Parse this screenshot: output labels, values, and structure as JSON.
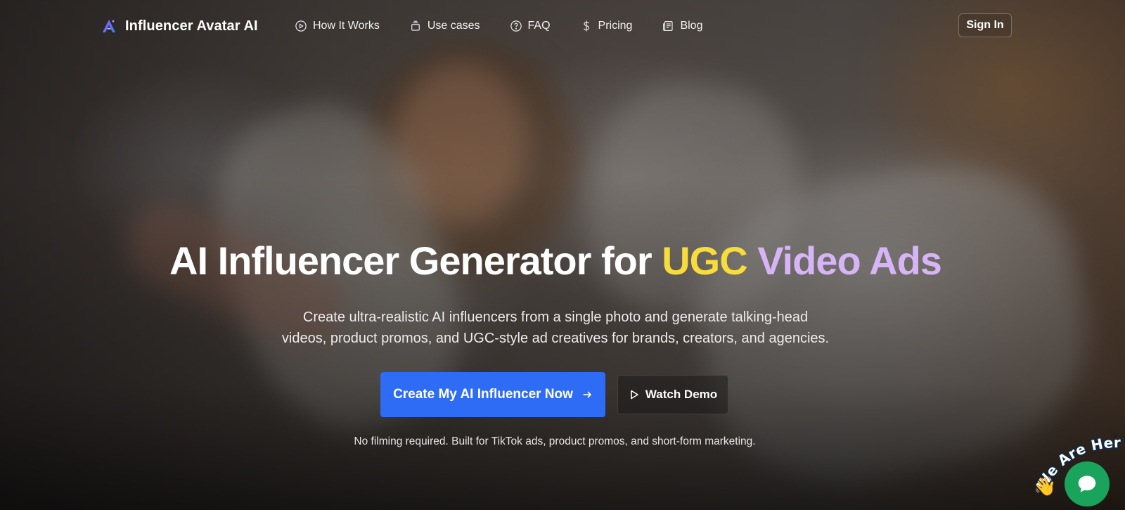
{
  "brand": {
    "name": "Influencer Avatar AI",
    "logo_icon": "a-logo-icon"
  },
  "nav": {
    "items": [
      {
        "label": "How It Works",
        "icon": "play-circle-icon"
      },
      {
        "label": "Use cases",
        "icon": "stack-icon"
      },
      {
        "label": "FAQ",
        "icon": "question-circle-icon"
      },
      {
        "label": "Pricing",
        "icon": "dollar-icon"
      },
      {
        "label": "Blog",
        "icon": "newspaper-icon"
      }
    ],
    "sign_in": "Sign In"
  },
  "hero": {
    "title_part1": "AI Influencer Generator for ",
    "title_part2": "UGC",
    "title_part3": " Video Ads",
    "subtitle_line1": "Create ultra-realistic AI influencers from a single photo and generate talking-head",
    "subtitle_line2": "videos, product promos, and UGC-style ad creatives for brands, creators, and agencies.",
    "primary_cta": "Create My AI Influencer Now",
    "secondary_cta": "Watch Demo",
    "note": "No filming required. Built for TikTok ads, product promos, and short-form marketing."
  },
  "chat_widget": {
    "label": "We Are Here!",
    "emoji": "👋",
    "close": "×"
  },
  "colors": {
    "accent_blue": "#2f6cf6",
    "title_yellow": "#f7dc3c",
    "title_purple": "#d6b4f5",
    "chat_green": "#1aa35a"
  }
}
